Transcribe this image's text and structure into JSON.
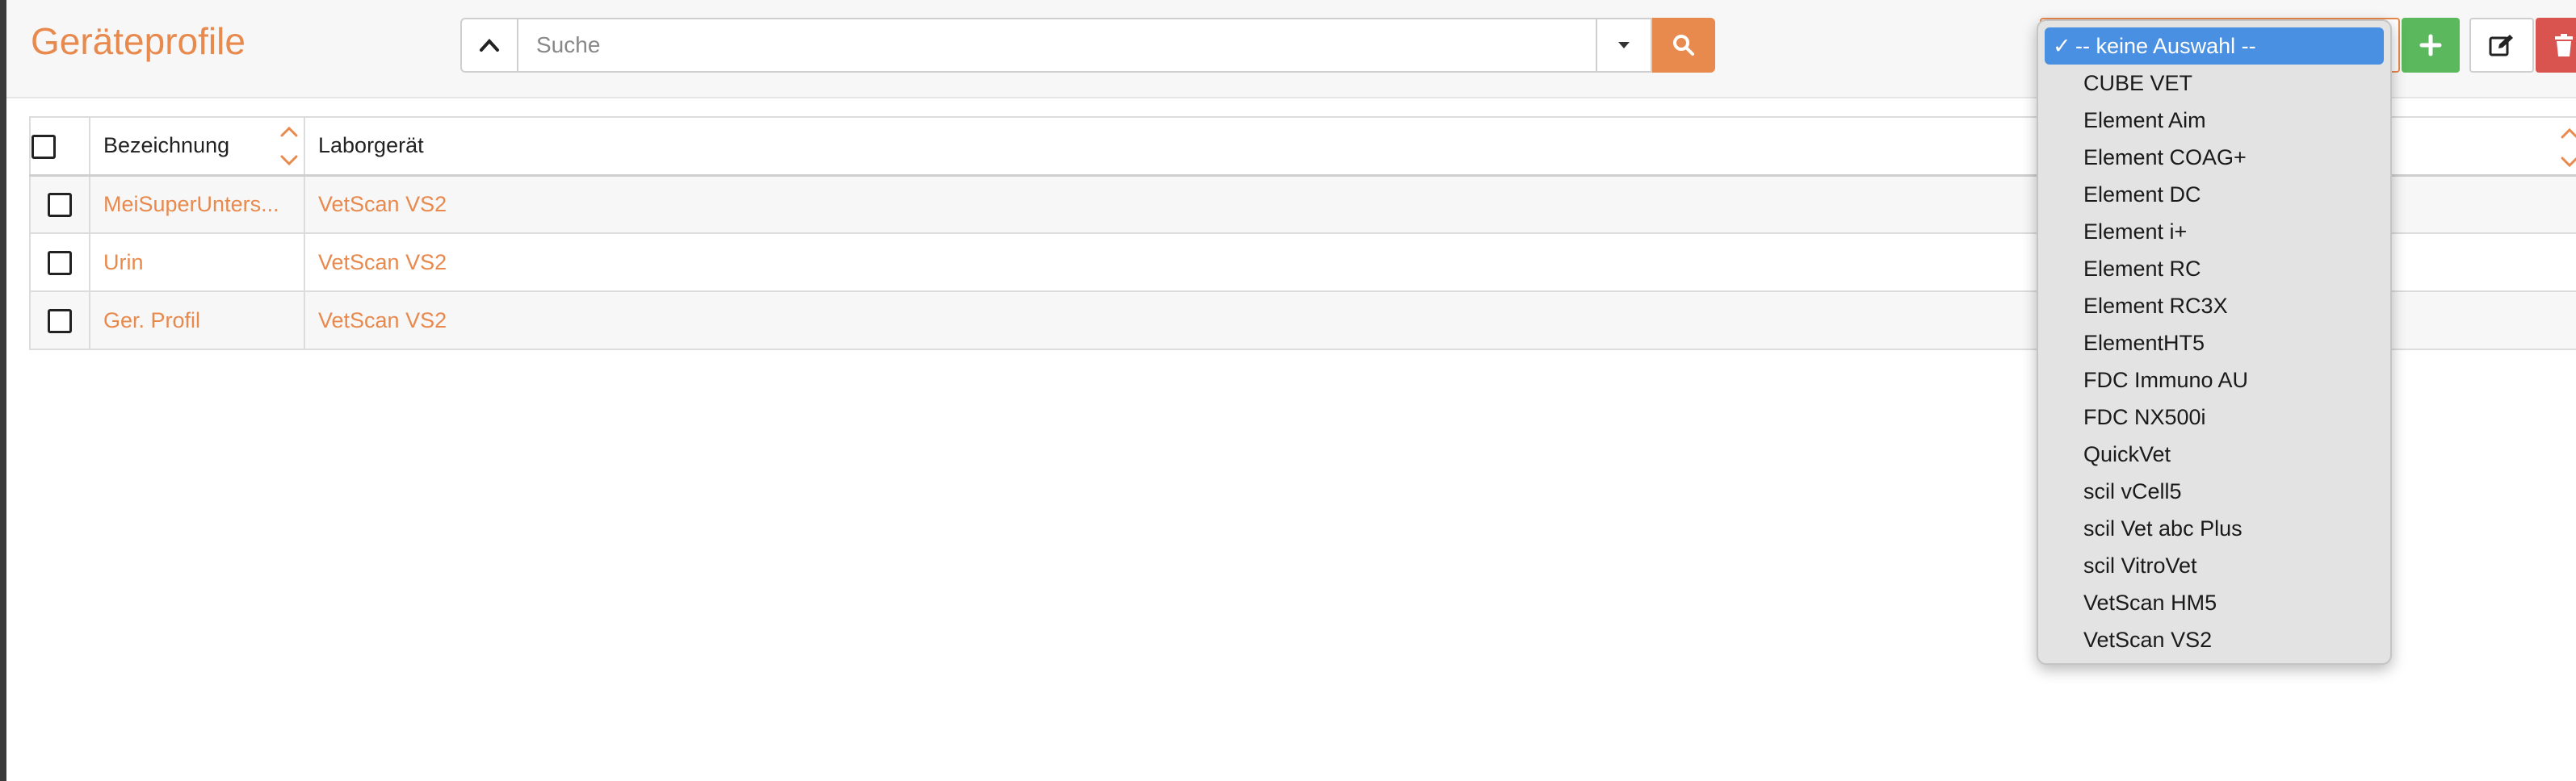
{
  "header": {
    "title": "Geräteprofile",
    "search_placeholder": "Suche",
    "search_value": ""
  },
  "icons": {
    "collapse": "chevron-up-icon",
    "dropdown": "caret-down-icon",
    "search": "search-icon",
    "add": "plus-icon",
    "edit": "edit-icon",
    "delete": "trash-icon"
  },
  "colors": {
    "accent": "#e8894d",
    "add": "#5cb85c",
    "delete": "#d9534f",
    "selected": "#4a90e2"
  },
  "table": {
    "headers": {
      "name": "Bezeichnung",
      "device": "Laborgerät"
    },
    "rows": [
      {
        "name": "MeiSuperUnters...",
        "device": "VetScan VS2"
      },
      {
        "name": "Urin",
        "device": "VetScan VS2"
      },
      {
        "name": "Ger. Profil",
        "device": "VetScan VS2"
      }
    ]
  },
  "device_select": {
    "selected": "-- keine Auswahl --",
    "options": [
      "-- keine Auswahl --",
      "CUBE VET",
      "Element Aim",
      "Element COAG+",
      "Element DC",
      "Element i+",
      "Element RC",
      "Element RC3X",
      "ElementHT5",
      "FDC Immuno AU",
      "FDC NX500i",
      "QuickVet",
      "scil vCell5",
      "scil Vet abc Plus",
      "scil VitroVet",
      "VetScan HM5",
      "VetScan VS2"
    ]
  }
}
